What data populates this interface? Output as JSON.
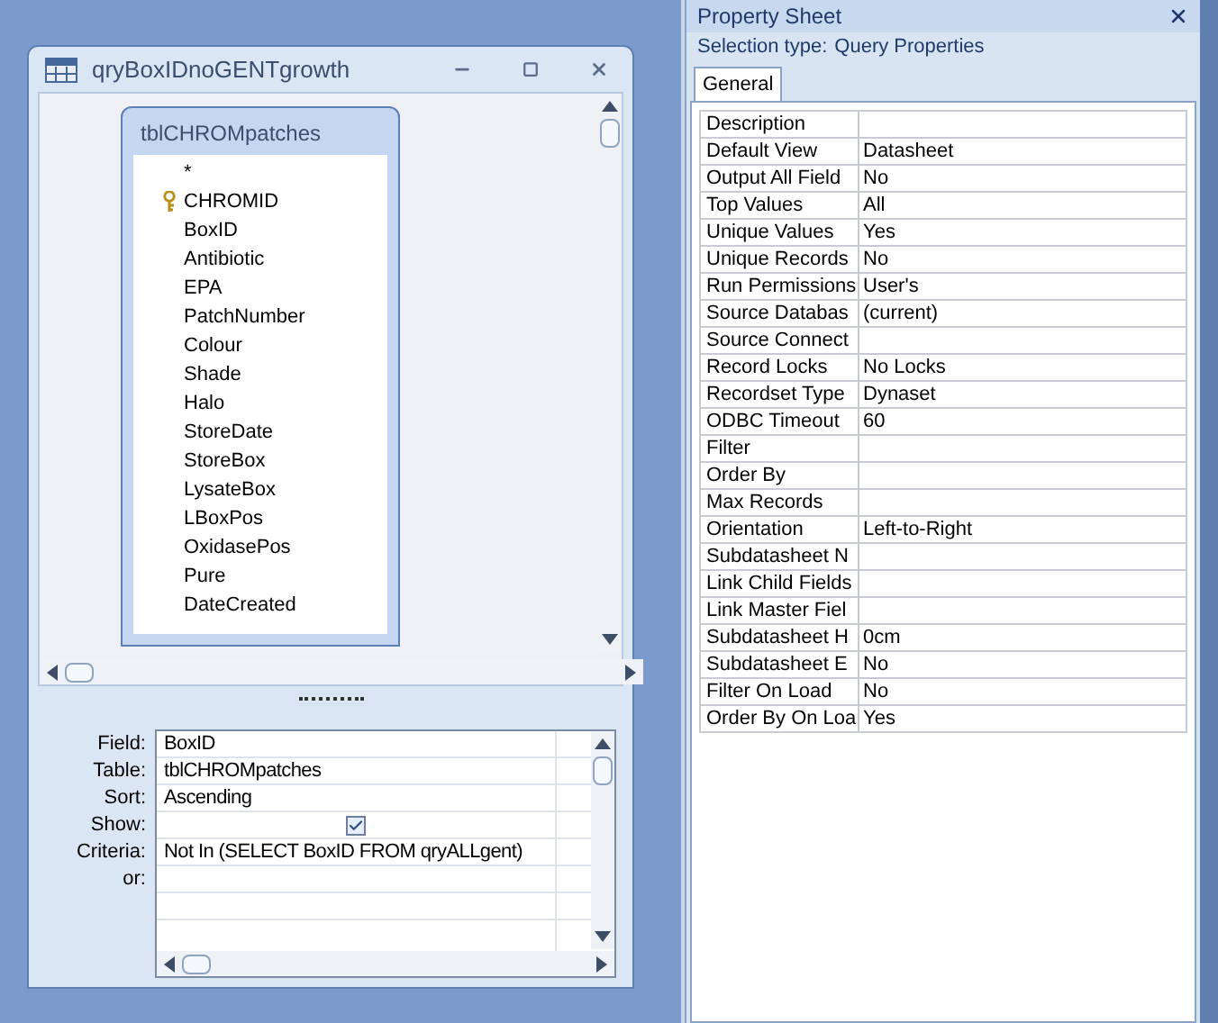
{
  "query_window": {
    "title": "qryBoxIDnoGENTgrowth"
  },
  "field_list": {
    "title": "tblCHROMpatches",
    "fields": [
      {
        "name": "*",
        "primary_key": false
      },
      {
        "name": "CHROMID",
        "primary_key": true
      },
      {
        "name": "BoxID",
        "primary_key": false
      },
      {
        "name": "Antibiotic",
        "primary_key": false
      },
      {
        "name": "EPA",
        "primary_key": false
      },
      {
        "name": "PatchNumber",
        "primary_key": false
      },
      {
        "name": "Colour",
        "primary_key": false
      },
      {
        "name": "Shade",
        "primary_key": false
      },
      {
        "name": "Halo",
        "primary_key": false
      },
      {
        "name": "StoreDate",
        "primary_key": false
      },
      {
        "name": "StoreBox",
        "primary_key": false
      },
      {
        "name": "LysateBox",
        "primary_key": false
      },
      {
        "name": "LBoxPos",
        "primary_key": false
      },
      {
        "name": "OxidasePos",
        "primary_key": false
      },
      {
        "name": "Pure",
        "primary_key": false
      },
      {
        "name": "DateCreated",
        "primary_key": false
      }
    ]
  },
  "design_grid": {
    "rows": [
      {
        "label": "Field:",
        "kind": "text",
        "value": "BoxID"
      },
      {
        "label": "Table:",
        "kind": "text",
        "value": "tblCHROMpatches"
      },
      {
        "label": "Sort:",
        "kind": "text",
        "value": "Ascending"
      },
      {
        "label": "Show:",
        "kind": "checkbox",
        "checked": true
      },
      {
        "label": "Criteria:",
        "kind": "text",
        "value": "Not In (SELECT BoxID FROM qryALLgent)"
      },
      {
        "label": "or:",
        "kind": "text"
      }
    ]
  },
  "property_sheet": {
    "title": "Property Sheet",
    "selection_type_label": "Selection type:",
    "selection_type": "Query Properties",
    "tabs": [
      {
        "label": "General",
        "selected": true
      }
    ],
    "properties": [
      {
        "name": "Description"
      },
      {
        "name": "Default View",
        "value": "Datasheet"
      },
      {
        "name": "Output All Field",
        "value": "No"
      },
      {
        "name": "Top Values",
        "value": "All"
      },
      {
        "name": "Unique Values",
        "value": "Yes"
      },
      {
        "name": "Unique Records",
        "value": "No"
      },
      {
        "name": "Run Permissions",
        "value": "User's"
      },
      {
        "name": "Source Databas",
        "value": "(current)"
      },
      {
        "name": "Source Connect"
      },
      {
        "name": "Record Locks",
        "value": "No Locks"
      },
      {
        "name": "Recordset Type",
        "value": "Dynaset"
      },
      {
        "name": "ODBC Timeout",
        "value": "60"
      },
      {
        "name": "Filter"
      },
      {
        "name": "Order By"
      },
      {
        "name": "Max Records"
      },
      {
        "name": "Orientation",
        "value": "Left-to-Right"
      },
      {
        "name": "Subdatasheet N"
      },
      {
        "name": "Link Child Fields"
      },
      {
        "name": "Link Master Fiel"
      },
      {
        "name": "Subdatasheet H",
        "value": "0cm"
      },
      {
        "name": "Subdatasheet E",
        "value": "No"
      },
      {
        "name": "Filter On Load",
        "value": "No"
      },
      {
        "name": "Order By On Loa",
        "value": "Yes"
      }
    ]
  }
}
